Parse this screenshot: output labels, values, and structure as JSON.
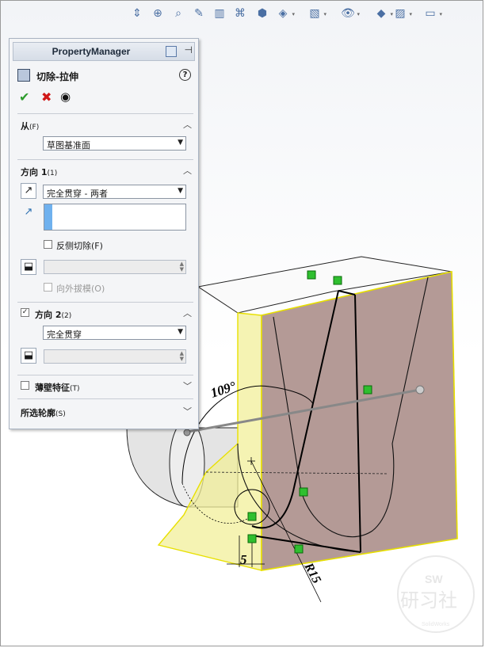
{
  "property_manager": {
    "header_title": "PropertyManager",
    "feature_title": "切除-拉伸",
    "help_label": "?",
    "from": {
      "label": "从",
      "accel": "(F)",
      "selected": "草图基准面"
    },
    "direction1": {
      "label": "方向 1",
      "accel": "(1)",
      "end_condition": "完全贯穿 - 两者",
      "flip_side_label": "反侧切除(F)",
      "draft_outward_label": "向外拔模(O)"
    },
    "direction2": {
      "label": "方向 2",
      "accel": "(2)",
      "checked": true,
      "end_condition": "完全贯穿"
    },
    "thin_feature": {
      "label": "薄壁特征",
      "accel": "(T)"
    },
    "selected_contours": {
      "label": "所选轮廓",
      "accel": "(S)"
    }
  },
  "drawing": {
    "angle_dim": "109°",
    "linear_dim": "5",
    "radius_dim": "R15"
  },
  "watermark": {
    "tag": "SW",
    "text": "研习社",
    "small": "SolidWorks"
  },
  "colors": {
    "preview_yellow": "#f2ef9a",
    "body_brown": "#b49a96",
    "edge_yellow": "#e8e000",
    "ok_green": "#2d9c2d",
    "cancel_red": "#d01818"
  }
}
